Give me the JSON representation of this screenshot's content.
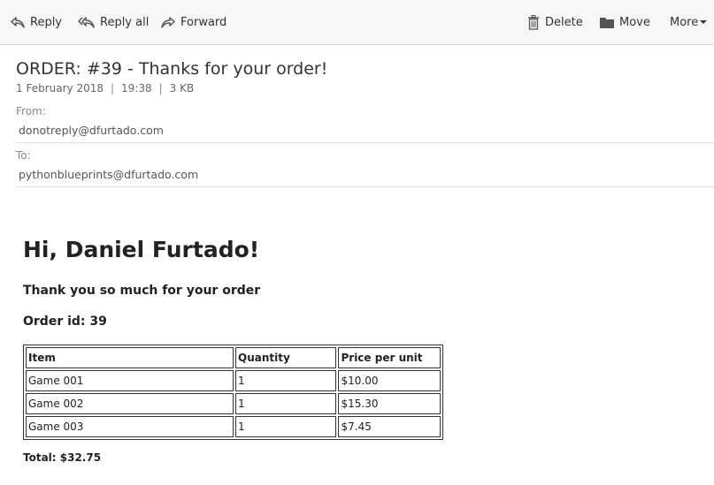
{
  "toolbar": {
    "reply": "Reply",
    "reply_all": "Reply all",
    "forward": "Forward",
    "delete": "Delete",
    "move": "Move",
    "more": "More"
  },
  "message": {
    "subject": "ORDER: #39 - Thanks for your order!",
    "date": "1 February 2018",
    "time": "19:38",
    "size": "3 KB",
    "from_label": "From:",
    "from": "donotreply@dfurtado.com",
    "to_label": "To:",
    "to": "pythonblueprints@dfurtado.com"
  },
  "body": {
    "greeting": "Hi, Daniel Furtado!",
    "thanks": "Thank you so much for your order",
    "order_id": "Order id: 39",
    "table": {
      "headers": [
        "Item",
        "Quantity",
        "Price per unit"
      ],
      "rows": [
        [
          "Game 001",
          "1",
          "$10.00"
        ],
        [
          "Game 002",
          "1",
          "$15.30"
        ],
        [
          "Game 003",
          "1",
          "$7.45"
        ]
      ]
    },
    "total": "Total: $32.75"
  },
  "icons": [
    "reply-icon",
    "reply-all-icon",
    "forward-icon",
    "trash-icon",
    "folder-icon",
    "caret-down-icon"
  ],
  "colors": {
    "toolbar_bg": "#f7f7f7",
    "text": "#333333",
    "muted": "#8a8a8a"
  }
}
